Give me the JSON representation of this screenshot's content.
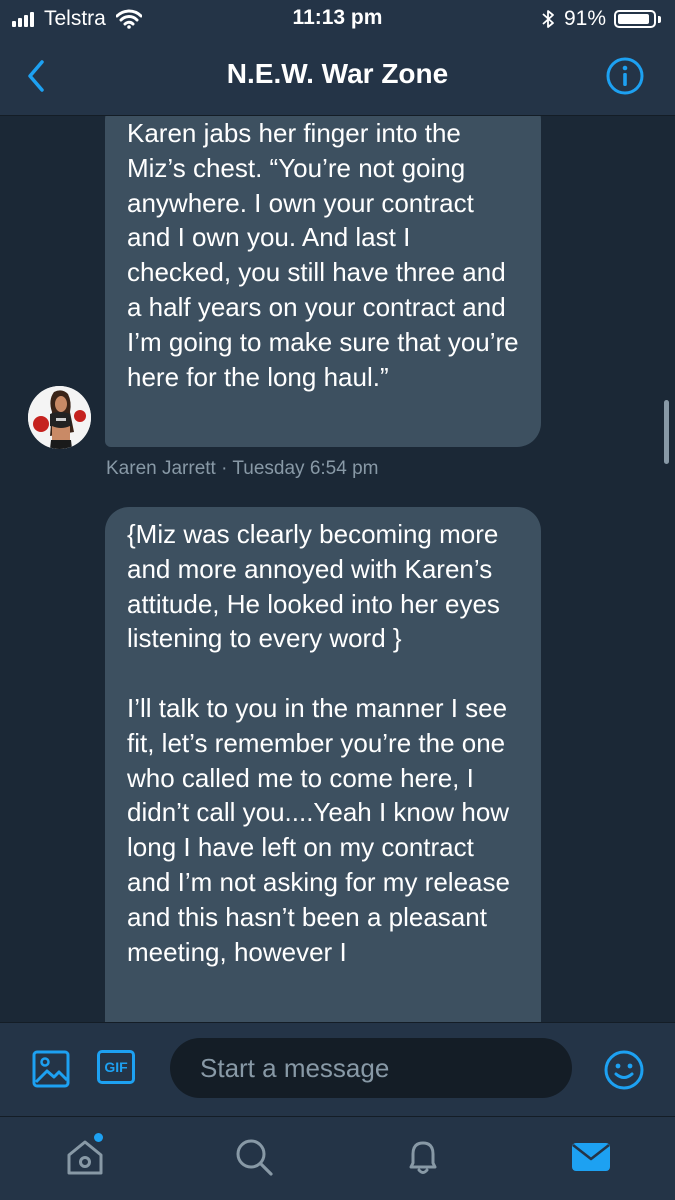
{
  "status_bar": {
    "carrier": "Telstra",
    "time": "11:13 pm",
    "battery_percent_label": "91%",
    "battery_level": 0.91,
    "signal_bars": 4,
    "icons": [
      "signal-bars-icon",
      "wifi-icon",
      "bluetooth-icon",
      "battery-icon"
    ]
  },
  "header": {
    "title": "N.E.W. War Zone",
    "back_icon": "chevron-left-icon",
    "info_icon": "info-icon"
  },
  "messages": [
    {
      "paragraphs": [
        "Karen jabs her finger into the Miz’s chest. “You’re not going anywhere. I own your contract and I own you. And last I checked, you still have three and a half years on your contract and I’m going to make sure that you’re here for the long haul.”"
      ],
      "sender": "Karen Jarrett",
      "separator": "·",
      "timestamp": "Tuesday 6:54 pm",
      "avatar_icon": "avatar"
    },
    {
      "paragraphs": [
        "{Miz was clearly becoming more and more annoyed with Karen’s attitude, He looked into her eyes listening to every word }",
        "I’ll talk to you in the manner I see fit, let’s remember you’re the one who called me to come here, I didn’t call you....Yeah I know how long I have left on my contract and I’m not asking for my release and this hasn’t been a pleasant meeting, however I"
      ]
    }
  ],
  "composer": {
    "placeholder": "Start a message",
    "gif_label": "GIF",
    "icons": [
      "image-icon",
      "gif-icon",
      "emoji-icon"
    ]
  },
  "tab_bar": {
    "icons": [
      "home-icon",
      "search-icon",
      "notifications-icon",
      "messages-icon"
    ],
    "active": "messages-icon"
  },
  "colors": {
    "accent": "#1da1f2",
    "background": "#1b2836",
    "bar": "#243447",
    "bubble": "#3d5060",
    "muted_text": "#8899a6"
  }
}
